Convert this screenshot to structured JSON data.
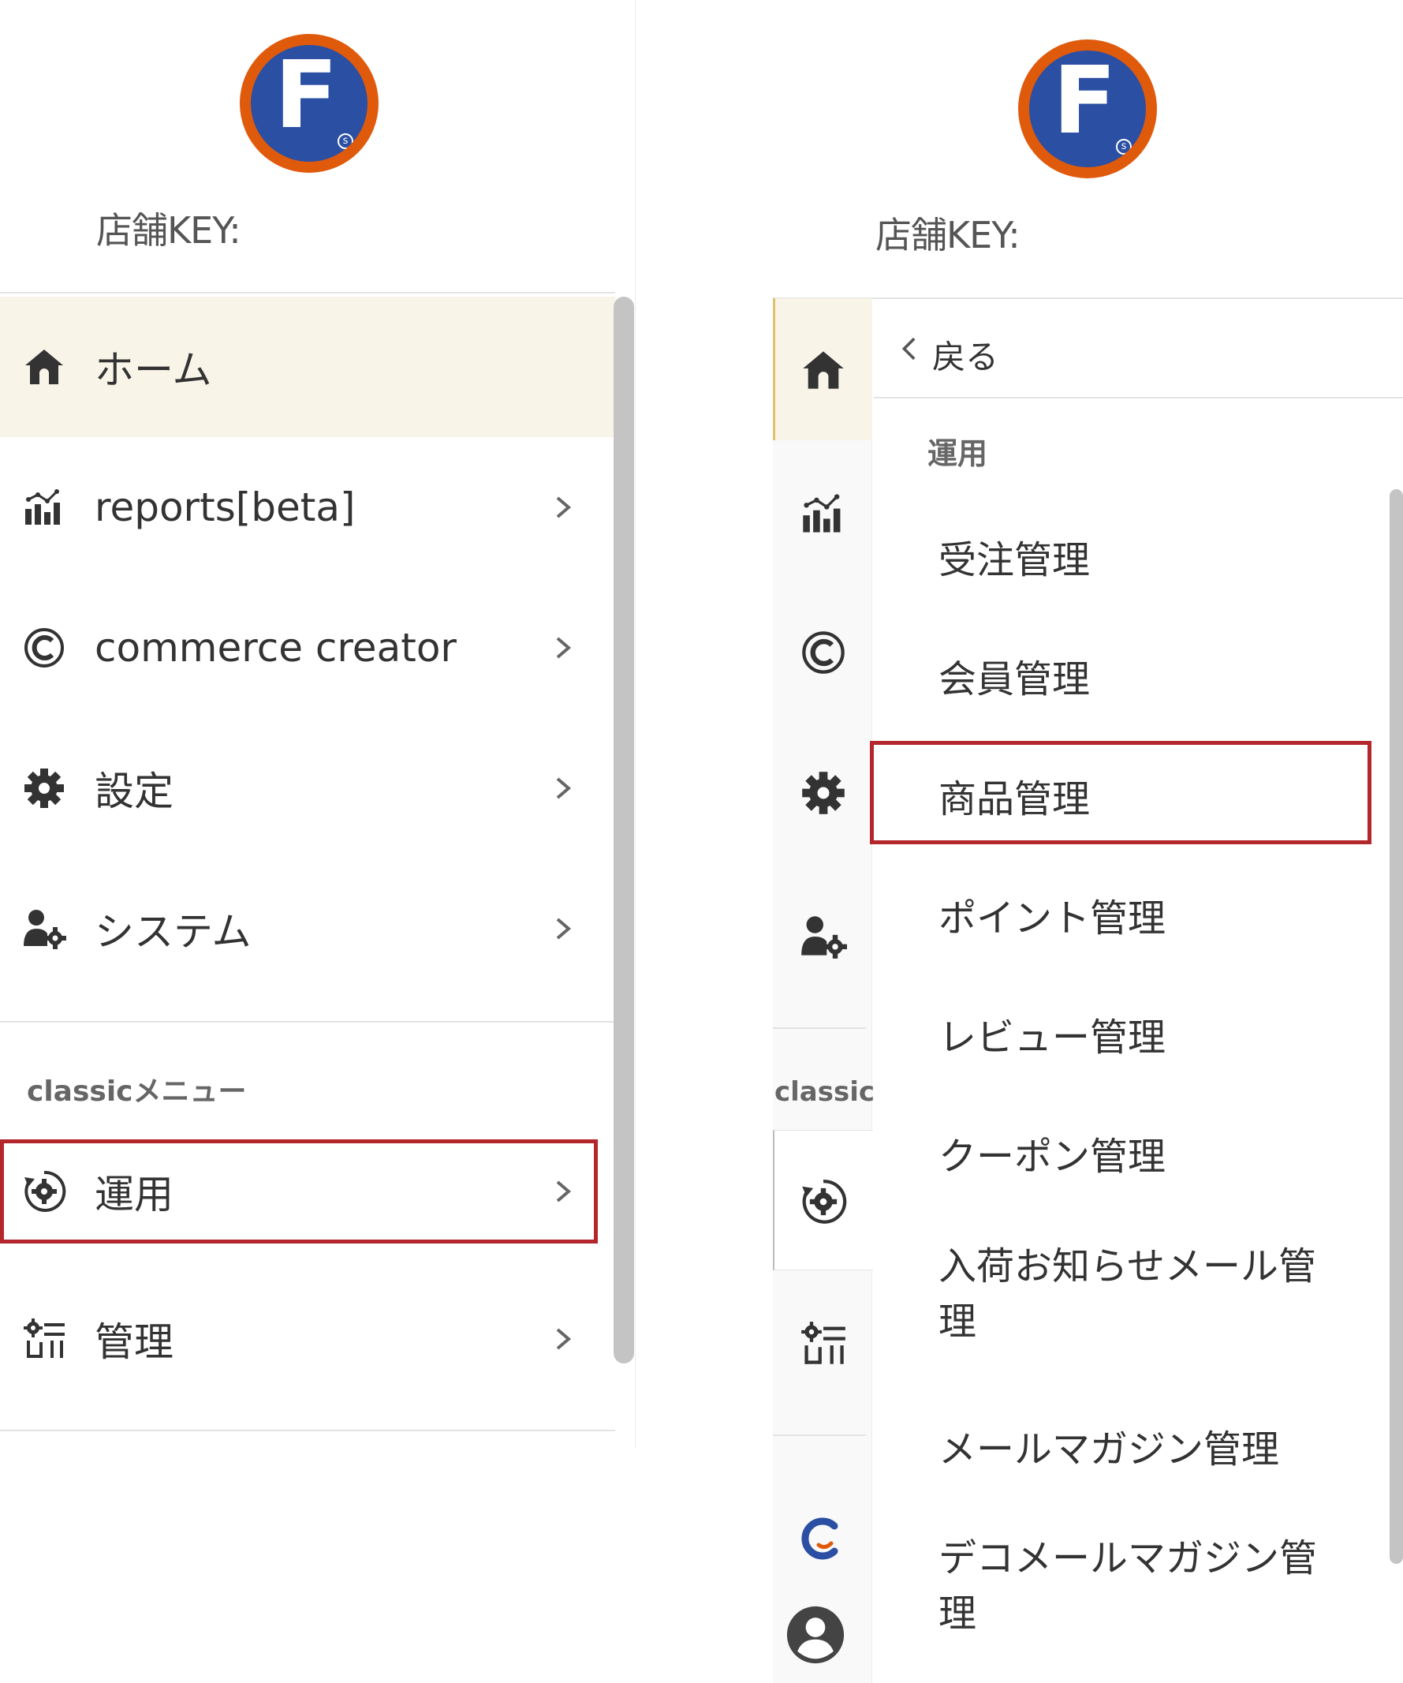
{
  "left_panel": {
    "store_key_label": "店舗KEY:",
    "menu": [
      {
        "label": "ホーム",
        "icon": "home-icon",
        "active": true
      },
      {
        "label": "reports[beta]",
        "icon": "bar-chart-icon"
      },
      {
        "label": "commerce creator",
        "icon": "copyright-icon"
      },
      {
        "label": "設定",
        "icon": "gear-icon"
      },
      {
        "label": "システム",
        "icon": "user-gear-icon"
      }
    ],
    "classic_section_label": "classicメニュー",
    "classic_menu": [
      {
        "label": "運用",
        "icon": "gear-cycle-icon",
        "highlighted": true
      },
      {
        "label": "管理",
        "icon": "admin-tools-icon"
      }
    ]
  },
  "right_panel": {
    "store_key_label": "店舗KEY:",
    "back_label": "戻る",
    "section_label": "運用",
    "rail_classic_label": "classic",
    "submenu": [
      {
        "label": "受注管理"
      },
      {
        "label": "会員管理"
      },
      {
        "label": "商品管理",
        "highlighted": true
      },
      {
        "label": "ポイント管理"
      },
      {
        "label": "レビュー管理"
      },
      {
        "label": "クーポン管理"
      },
      {
        "label": "入荷お知らせメール管理"
      },
      {
        "label": "メールマガジン管理"
      },
      {
        "label": "デコメールマガジン管理"
      }
    ]
  },
  "colors": {
    "highlight_border": "#b3262c",
    "active_row_bg": "#f8f4e8",
    "logo_ring": "#e05a0c",
    "logo_fill": "#2a4fa3"
  }
}
